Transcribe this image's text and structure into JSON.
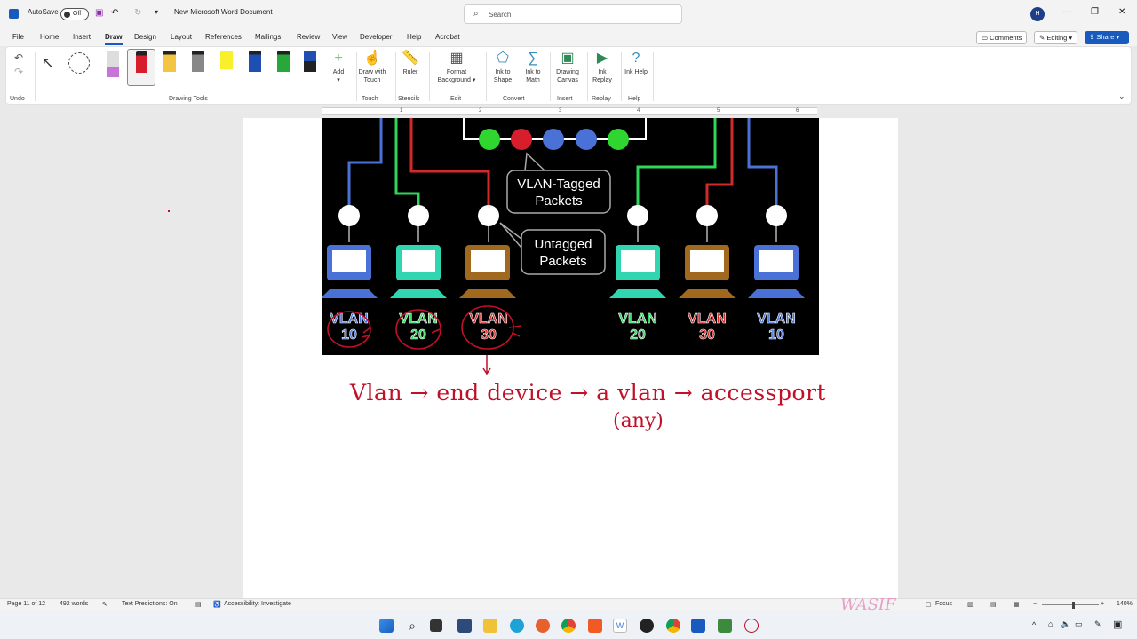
{
  "titlebar": {
    "autosave_label": "AutoSave",
    "autosave_state": "Off",
    "doc_title": "New Microsoft Word Document",
    "search_placeholder": "Search",
    "avatar_initial": "H"
  },
  "menu": {
    "tabs": [
      "File",
      "Home",
      "Insert",
      "Draw",
      "Design",
      "Layout",
      "References",
      "Mailings",
      "Review",
      "View",
      "Developer",
      "Help",
      "Acrobat"
    ],
    "active_tab": "Draw",
    "comments_label": "Comments",
    "editing_label": "Editing",
    "share_label": "Share"
  },
  "ribbon": {
    "groups": {
      "undo": "Undo",
      "drawing_tools": "Drawing Tools",
      "touch": "Touch",
      "stencils": "Stencils",
      "edit": "Edit",
      "convert": "Convert",
      "insert": "Insert",
      "replay": "Replay",
      "help": "Help"
    },
    "buttons": {
      "add": "Add",
      "draw_with_touch": "Draw with Touch",
      "ruler": "Ruler",
      "format_background": "Format Background",
      "ink_to_shape": "Ink to Shape",
      "ink_to_math": "Ink to Math",
      "drawing_canvas": "Drawing Canvas",
      "ink_replay": "Ink Replay",
      "ink_help": "Ink Help"
    }
  },
  "ruler": {
    "numbers": [
      "1",
      "2",
      "3",
      "4",
      "5",
      "6"
    ]
  },
  "diagram": {
    "tagged_label_1": "VLAN-Tagged",
    "tagged_label_2": "Packets",
    "untagged_label_1": "Untagged",
    "untagged_label_2": "Packets",
    "vlans": [
      {
        "name": "VLAN",
        "num": "10",
        "color": "#4a72d6"
      },
      {
        "name": "VLAN",
        "num": "20",
        "color": "#2fd65a"
      },
      {
        "name": "VLAN",
        "num": "30",
        "color": "#d12a2a"
      },
      {
        "name": "VLAN",
        "num": "20",
        "color": "#2fd65a"
      },
      {
        "name": "VLAN",
        "num": "30",
        "color": "#d12a2a"
      },
      {
        "name": "VLAN",
        "num": "10",
        "color": "#4a72d6"
      }
    ]
  },
  "handwriting": {
    "line1": "Vlan → end device → a vlan → accessport",
    "line2": "(any)",
    "ink_color": "#c0102a"
  },
  "status": {
    "page": "Page 11 of 12",
    "words": "492 words",
    "text_predictions": "Text Predictions: On",
    "accessibility": "Accessibility: Investigate",
    "focus": "Focus",
    "zoom": "140%",
    "watermark": "WASIF"
  }
}
